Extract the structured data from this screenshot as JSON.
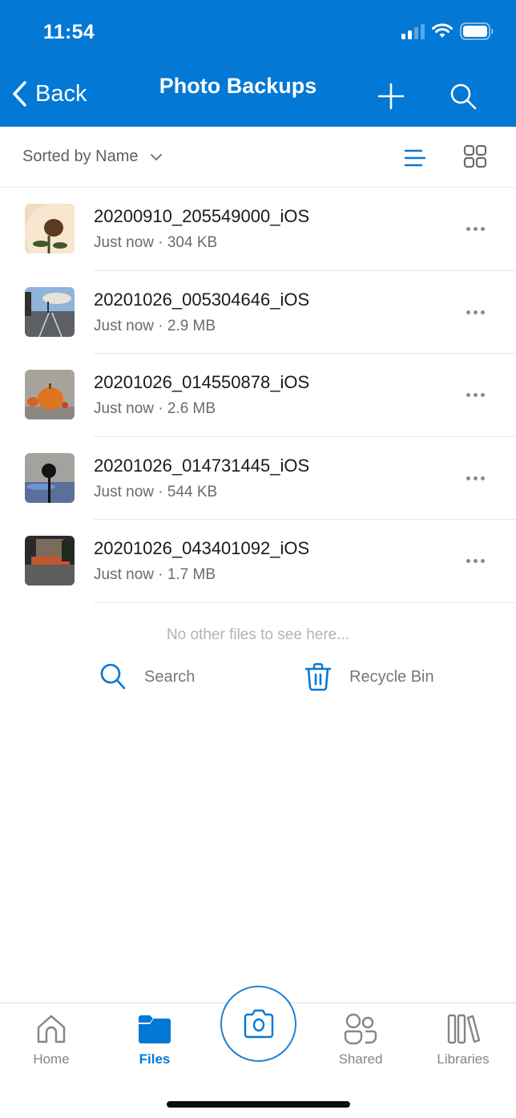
{
  "colors": {
    "accent": "#0378d4",
    "header_bg": "#0378d4",
    "text_primary": "#1a1a1a",
    "text_secondary": "#6b6b6b"
  },
  "status_bar": {
    "time": "11:54",
    "icons": [
      "cellular-signal-icon",
      "wifi-icon",
      "battery-icon"
    ]
  },
  "nav": {
    "back_label": "Back",
    "title": "Photo Backups",
    "actions": [
      "plus-icon",
      "search-icon"
    ]
  },
  "sort": {
    "label": "Sorted by Name",
    "view_modes": [
      "list",
      "grid"
    ],
    "active_view": "list"
  },
  "files": [
    {
      "name": "20200910_205549000_iOS",
      "meta": "Just now · 304 KB",
      "thumb": "sunflower"
    },
    {
      "name": "20201026_005304646_iOS",
      "meta": "Just now · 2.9 MB",
      "thumb": "street"
    },
    {
      "name": "20201026_014550878_iOS",
      "meta": "Just now · 2.6 MB",
      "thumb": "pumpkin"
    },
    {
      "name": "20201026_014731445_iOS",
      "meta": "Just now · 544 KB",
      "thumb": "palm-tree"
    },
    {
      "name": "20201026_043401092_iOS",
      "meta": "Just now · 1.7 MB",
      "thumb": "building-night"
    }
  ],
  "footer": {
    "empty_message": "No other files to see here...",
    "search_label": "Search",
    "recycle_label": "Recycle Bin"
  },
  "tabs": [
    {
      "label": "Home",
      "icon": "home-icon",
      "active": false
    },
    {
      "label": "Files",
      "icon": "folder-icon",
      "active": true
    },
    {
      "label": "",
      "icon": "camera-icon",
      "active": false
    },
    {
      "label": "Shared",
      "icon": "shared-people-icon",
      "active": false
    },
    {
      "label": "Libraries",
      "icon": "libraries-icon",
      "active": false
    }
  ]
}
